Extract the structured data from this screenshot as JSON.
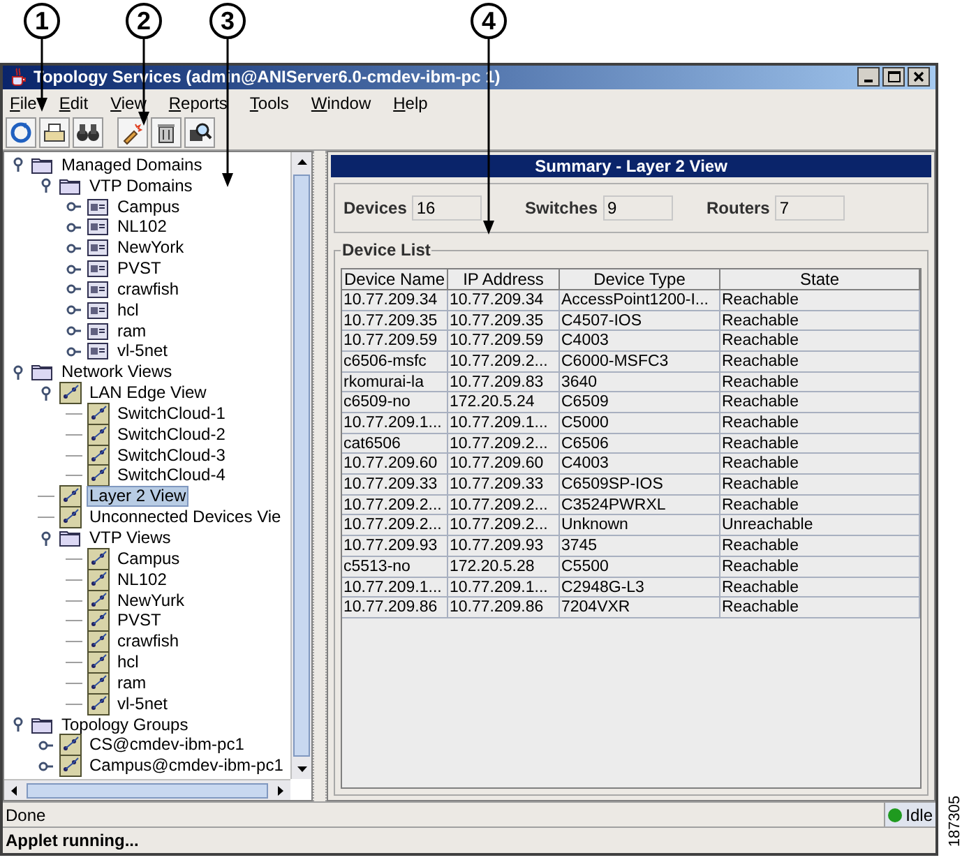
{
  "callouts": [
    {
      "label": "1"
    },
    {
      "label": "2"
    },
    {
      "label": "3"
    },
    {
      "label": "4"
    }
  ],
  "window": {
    "title": "Topology Services (admin@ANIServer6.0-cmdev-ibm-pc 1)"
  },
  "menu": [
    {
      "label": "File"
    },
    {
      "label": "Edit"
    },
    {
      "label": "View"
    },
    {
      "label": "Reports"
    },
    {
      "label": "Tools"
    },
    {
      "label": "Window"
    },
    {
      "label": "Help"
    }
  ],
  "toolbar": [
    {
      "kind": "refresh"
    },
    {
      "kind": "print"
    },
    {
      "kind": "find"
    },
    {
      "kind": "brush"
    },
    {
      "kind": "trash"
    },
    {
      "kind": "zoom"
    }
  ],
  "tree": [
    {
      "label": "Managed Domains",
      "kind": "folder",
      "expanded": true,
      "selected": false,
      "children": [
        {
          "label": "VTP Domains",
          "kind": "folder",
          "expanded": true,
          "selected": false,
          "children": [
            {
              "label": "Campus",
              "kind": "domain",
              "expanded": false,
              "selected": false
            },
            {
              "label": "NL102",
              "kind": "domain",
              "expanded": false,
              "selected": false
            },
            {
              "label": "NewYork",
              "kind": "domain",
              "expanded": false,
              "selected": false
            },
            {
              "label": "PVST",
              "kind": "domain",
              "expanded": false,
              "selected": false
            },
            {
              "label": "crawfish",
              "kind": "domain",
              "expanded": false,
              "selected": false
            },
            {
              "label": "hcl",
              "kind": "domain",
              "expanded": false,
              "selected": false
            },
            {
              "label": "ram",
              "kind": "domain",
              "expanded": false,
              "selected": false
            },
            {
              "label": "vl-5net",
              "kind": "domain",
              "expanded": false,
              "selected": false
            }
          ]
        }
      ]
    },
    {
      "label": "Network Views",
      "kind": "folder",
      "expanded": true,
      "selected": false,
      "children": [
        {
          "label": "LAN Edge View",
          "kind": "view",
          "expanded": true,
          "selected": false,
          "children": [
            {
              "label": "SwitchCloud-1",
              "kind": "view",
              "selected": false
            },
            {
              "label": "SwitchCloud-2",
              "kind": "view",
              "selected": false
            },
            {
              "label": "SwitchCloud-3",
              "kind": "view",
              "selected": false
            },
            {
              "label": "SwitchCloud-4",
              "kind": "view",
              "selected": false
            }
          ]
        },
        {
          "label": "Layer 2 View",
          "kind": "view",
          "selected": true
        },
        {
          "label": "Unconnected Devices Vie",
          "kind": "view",
          "selected": false
        },
        {
          "label": "VTP Views",
          "kind": "folder",
          "expanded": true,
          "selected": false,
          "children": [
            {
              "label": "Campus",
              "kind": "view",
              "selected": false
            },
            {
              "label": "NL102",
              "kind": "view",
              "selected": false
            },
            {
              "label": "NewYurk",
              "kind": "view",
              "selected": false
            },
            {
              "label": "PVST",
              "kind": "view",
              "selected": false
            },
            {
              "label": "crawfish",
              "kind": "view",
              "selected": false
            },
            {
              "label": "hcl",
              "kind": "view",
              "selected": false
            },
            {
              "label": "ram",
              "kind": "view",
              "selected": false
            },
            {
              "label": "vl-5net",
              "kind": "view",
              "selected": false
            }
          ]
        }
      ]
    },
    {
      "label": "Topology Groups",
      "kind": "folder",
      "expanded": true,
      "selected": false,
      "children": [
        {
          "label": "CS@cmdev-ibm-pc1",
          "kind": "view",
          "expanded": false,
          "selected": false
        },
        {
          "label": "Campus@cmdev-ibm-pc1",
          "kind": "view",
          "expanded": false,
          "selected": false
        }
      ]
    }
  ],
  "summary": {
    "title": "Summary - Layer 2 View",
    "counts": [
      {
        "label": "Devices",
        "value": "16"
      },
      {
        "label": "Switches",
        "value": "9"
      },
      {
        "label": "Routers",
        "value": "7"
      }
    ]
  },
  "device_list": {
    "title": "Device List",
    "columns": [
      "Device Name",
      "IP Address",
      "Device Type",
      "State"
    ],
    "rows": [
      [
        "10.77.209.34",
        "10.77.209.34",
        "AccessPoint1200-I...",
        "Reachable"
      ],
      [
        "10.77.209.35",
        "10.77.209.35",
        "C4507-IOS",
        "Reachable"
      ],
      [
        "10.77.209.59",
        "10.77.209.59",
        "C4003",
        "Reachable"
      ],
      [
        "c6506-msfc",
        "10.77.209.2...",
        "C6000-MSFC3",
        "Reachable"
      ],
      [
        "rkomurai-la",
        "10.77.209.83",
        "3640",
        "Reachable"
      ],
      [
        "c6509-no",
        "172.20.5.24",
        "C6509",
        "Reachable"
      ],
      [
        "10.77.209.1...",
        "10.77.209.1...",
        "C5000",
        "Reachable"
      ],
      [
        "cat6506",
        "10.77.209.2...",
        "C6506",
        "Reachable"
      ],
      [
        "10.77.209.60",
        "10.77.209.60",
        "C4003",
        "Reachable"
      ],
      [
        "10.77.209.33",
        "10.77.209.33",
        "C6509SP-IOS",
        "Reachable"
      ],
      [
        "10.77.209.2...",
        "10.77.209.2...",
        "C3524PWRXL",
        "Reachable"
      ],
      [
        "10.77.209.2...",
        "10.77.209.2...",
        "Unknown",
        "Unreachable"
      ],
      [
        "10.77.209.93",
        "10.77.209.93",
        "3745",
        "Reachable"
      ],
      [
        "c5513-no",
        "172.20.5.28",
        "C5500",
        "Reachable"
      ],
      [
        "10.77.209.1...",
        "10.77.209.1...",
        "C2948G-L3",
        "Reachable"
      ],
      [
        "10.77.209.86",
        "10.77.209.86",
        "7204VXR",
        "Reachable"
      ]
    ]
  },
  "status_bar": {
    "text": "Done",
    "state": "Idle",
    "color": "#1f9a1f"
  },
  "applet_status": "Applet running...",
  "figure_number": "187305"
}
